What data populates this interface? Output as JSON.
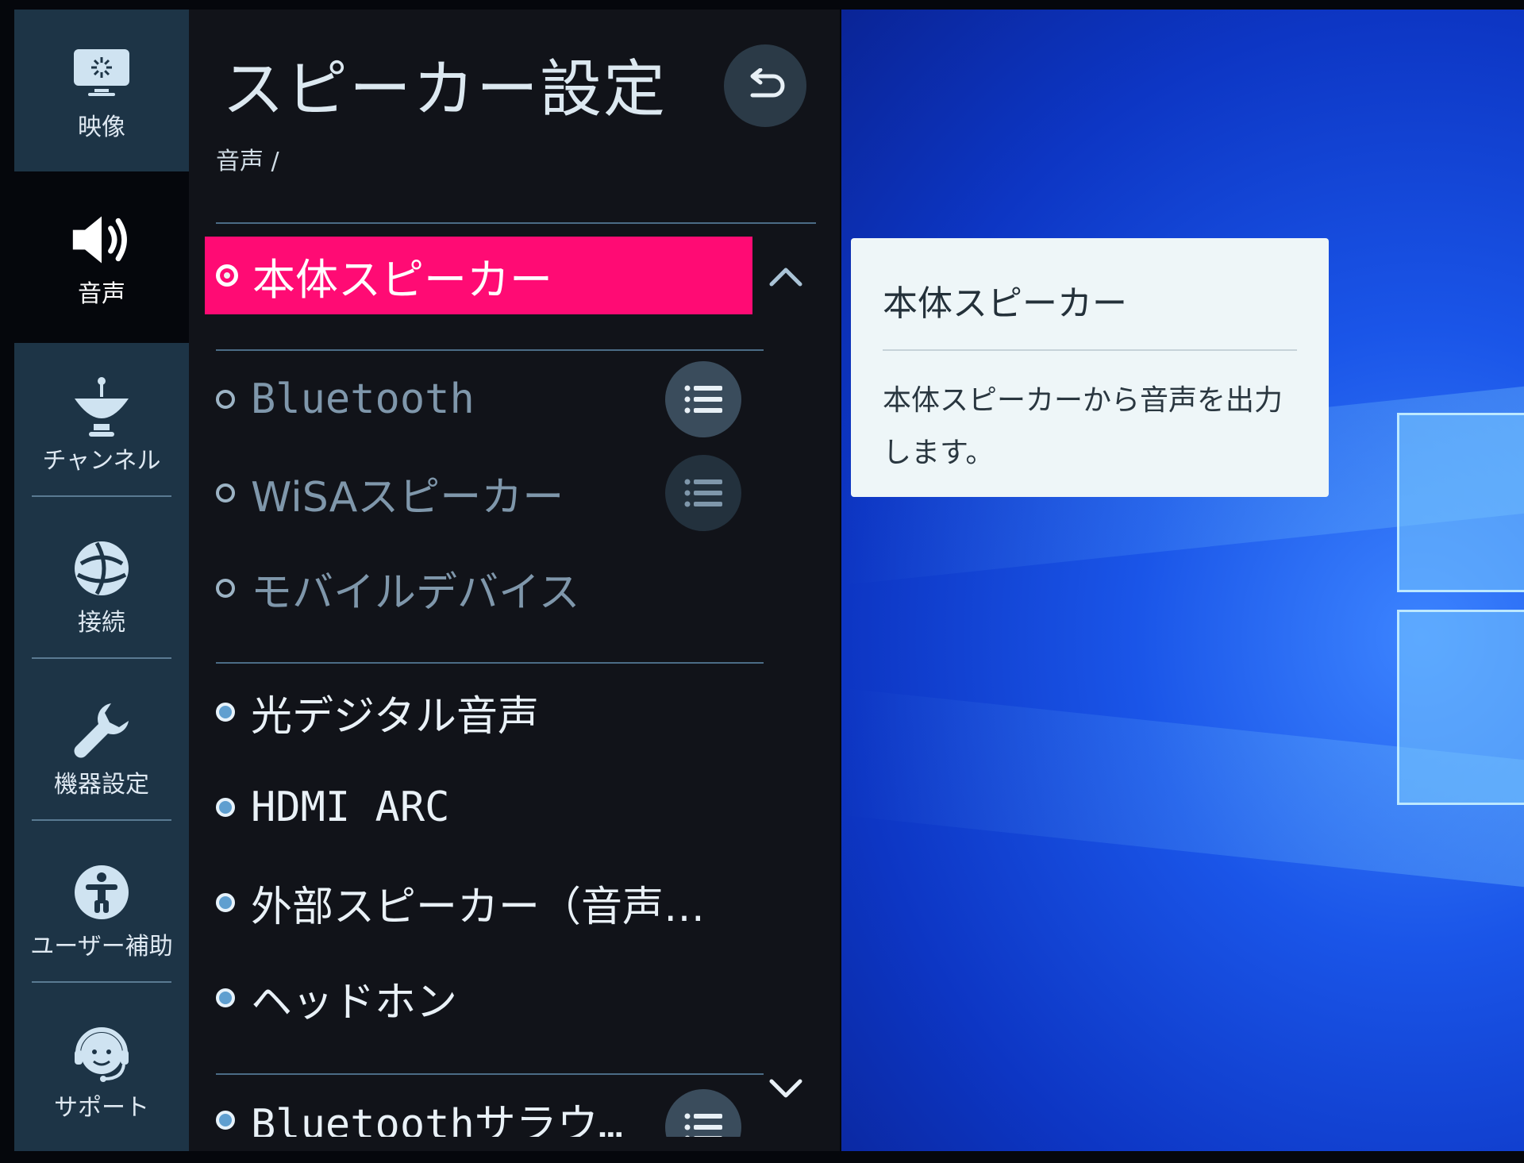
{
  "header": {
    "title": "スピーカー設定",
    "breadcrumb": "音声 /"
  },
  "sidebar": {
    "items": [
      {
        "label": "映像",
        "icon": "picture-icon"
      },
      {
        "label": "音声",
        "icon": "speaker-icon",
        "active": true
      },
      {
        "label": "チャンネル",
        "icon": "antenna-icon"
      },
      {
        "label": "接続",
        "icon": "globe-icon"
      },
      {
        "label": "機器設定",
        "icon": "wrench-icon"
      },
      {
        "label": "ユーザー補助",
        "icon": "accessibility-icon"
      },
      {
        "label": "サポート",
        "icon": "headset-icon"
      }
    ]
  },
  "options": {
    "selected": "本体スピーカー",
    "group2": [
      "Bluetooth",
      "WiSAスピーカー",
      "モバイルデバイス"
    ],
    "group3": [
      "光デジタル音声",
      "HDMI ARC",
      "外部スピーカー（音声…",
      "ヘッドホン"
    ],
    "group4": [
      "Bluetoothサラウ…"
    ]
  },
  "detail": {
    "title": "本体スピーカー",
    "description": "本体スピーカーから音声を出力します。"
  },
  "colors": {
    "accent": "#ff0b74",
    "sidebar": "#1d3446",
    "panel": "#111319"
  }
}
